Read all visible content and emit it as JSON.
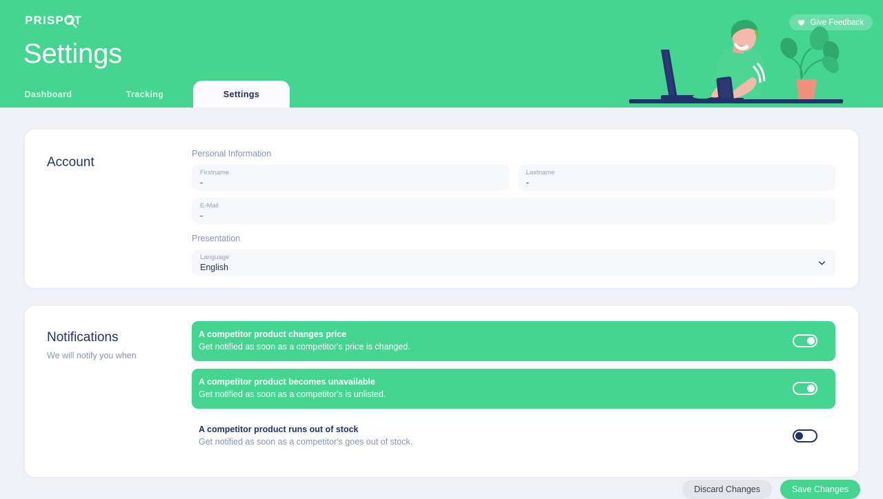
{
  "brand": {
    "logo_text": "PRISPOT",
    "logo_icon": "magnifier-check-icon",
    "accent_color": "#44D591",
    "dark_color": "#22306B",
    "page_bg": "#F0F1F7"
  },
  "header": {
    "title": "Settings",
    "feedback_button": "Give Feedback",
    "feedback_icon": "heart-icon",
    "illustration": "person-at-desk-with-laptop-and-plant-illustration"
  },
  "tabs": [
    {
      "label": "Dashboard",
      "active": false
    },
    {
      "label": "Tracking",
      "active": false
    },
    {
      "label": "Settings",
      "active": true
    }
  ],
  "account": {
    "heading": "Account",
    "personal_information_label": "Personal Information",
    "presentation_label": "Presentation",
    "fields": [
      {
        "label": "Firstname",
        "value": "-",
        "placeholder": "-"
      },
      {
        "label": "Lastname",
        "value": "-",
        "placeholder": "-"
      },
      {
        "label": "E-Mail",
        "value": "-",
        "placeholder": "-"
      }
    ],
    "language": {
      "label": "Language",
      "value": "English",
      "chevron_icon": "chevron-down-icon",
      "options": [
        "English"
      ]
    }
  },
  "notifications": {
    "heading": "Notifications",
    "subheading": "We will notify you when",
    "items": [
      {
        "title": "A competitor product changes price",
        "description": "Get notified as soon as a competitor's price is changed.",
        "enabled": true
      },
      {
        "title": "A competitor product becomes unavailable",
        "description": "Get notified as soon as a competitor's is unlisted.",
        "enabled": true
      },
      {
        "title": "A competitor product runs out of stock",
        "description": "Get notified as soon as a competitor's goes out of stock.",
        "enabled": false
      }
    ]
  },
  "footer": {
    "discard_label": "Discard Changes",
    "save_label": "Save Changes"
  }
}
